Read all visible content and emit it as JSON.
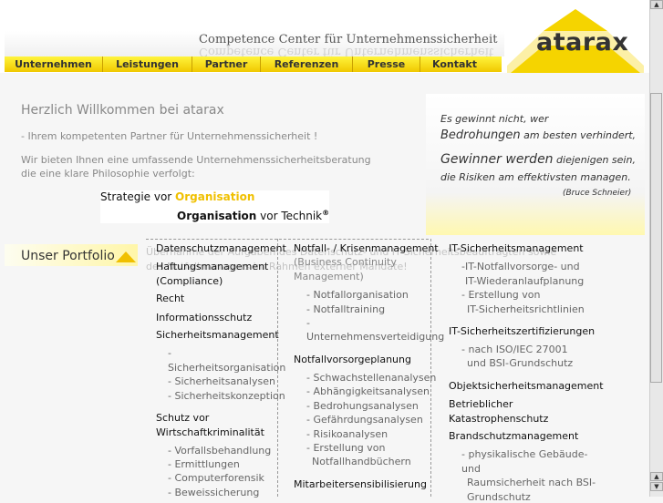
{
  "header": {
    "title": "Competence Center für Unternehmenssicherheit",
    "logo": "atarax",
    "nav": [
      "Unternehmen",
      "Leistungen",
      "Partner",
      "Referenzen",
      "Presse",
      "Kontakt"
    ]
  },
  "welcome": {
    "heading": "Herzlich Willkommen bei atarax",
    "partner": "- Ihrem kompetenten Partner für Unternehmenssicherheit !",
    "intro_line1": "Wir bieten Ihnen eine umfassende Unternehmenssicherheitsberatung",
    "intro_line2": "die eine klare Philosophie verfolgt:",
    "strategy": {
      "l1_a": "Strategie vor ",
      "l1_b": "Organisation",
      "l2_a": "Organisation",
      "l2_b": " vor Technik",
      "l2_sup": "®"
    }
  },
  "quote": {
    "l1": "Es gewinnt nicht, wer",
    "l2a": "Bedrohungen",
    "l2b": " am besten verhindert,",
    "l3a": "Gewinner werden",
    "l3b": " diejenigen sein,",
    "l4": "die Risiken am effektivsten managen.",
    "author": "(Bruce Schneier)"
  },
  "portfolio": {
    "label": "Unser Portfolio",
    "ghost1": "Übernahme der Aufgaben des Datenschutz- und IT-Sicherheitsbeauftragten sowie",
    "ghost2": "des Notfallmanagers im Rahmen externer Mandate!",
    "col1": {
      "datenschutz": "Datenschutzmanagement",
      "haftung1": "Haftungsmanagement",
      "haftung2": "(Compliance)",
      "recht": "Recht",
      "info": "Informationsschutz",
      "sicherheit": "Sicherheitsmanagement",
      "s_dash": "-",
      "s1": "Sicherheitsorganisation",
      "s2": "- Sicherheitsanalysen",
      "s3": "- Sicherheitskonzeption",
      "schutz1": "Schutz vor",
      "schutz2": "Wirtschaftkriminalität",
      "w1": "- Vorfallsbehandlung",
      "w2": "- Ermittlungen",
      "w3": "- Computerforensik",
      "w4": "- Beweissicherung"
    },
    "col2": {
      "notfall1": "Notfall- / Krisenmanagement",
      "notfall2": "(Business Continuity",
      "notfall3": "Management)",
      "n1": "- Notfallorganisation",
      "n2": "- Notfalltraining",
      "n3a": "-",
      "n3b": "Unternehmensverteidigung",
      "vorsorge": "Notfallvorsorgeplanung",
      "v1": "- Schwachstellenanalysen",
      "v2": "- Abhängigkeitsanalysen",
      "v3": "- Bedrohungsanalysen",
      "v4": "- Gefährdungsanalysen",
      "v5": "- Risikoanalysen",
      "v6a": "- Erstellung von",
      "v6b": "Notfallhandbüchern",
      "sensib": "Mitarbeitersensibilisierung"
    },
    "col3": {
      "it": "IT-Sicherheitsmanagement",
      "i1": "-IT-Notfallvorsorge- und",
      "i2": "IT-Wiederanlaufplanung",
      "i3": "- Erstellung von",
      "i4": "IT-Sicherheitsrichtlinien",
      "zert": "IT-Sicherheitszertifizierungen",
      "z1": "- nach ISO/IEC 27001",
      "z2": "und BSI-Grundschutz",
      "objekt": "Objektsicherheitsmanagement",
      "kat1": "Betrieblicher",
      "kat2": "Katastrophenschutz",
      "brand": "Brandschutzmanagement",
      "b1": "- physikalische Gebäude-",
      "b2": "und",
      "b3": "Raumsicherheit nach BSI-",
      "b4": "Grundschutz"
    }
  },
  "colors": {
    "accent": "#f0c800",
    "text": "#111111",
    "muted": "#888888"
  }
}
